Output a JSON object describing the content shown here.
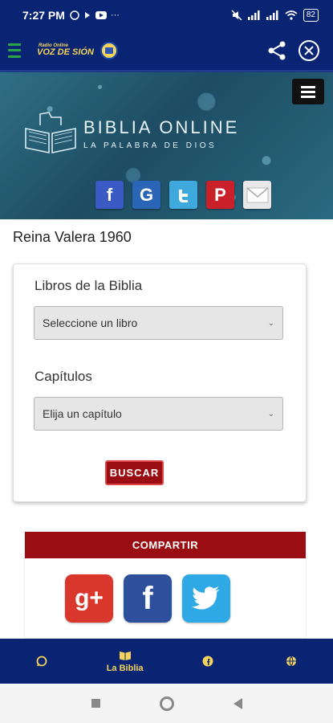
{
  "status_bar": {
    "time": "7:27 PM",
    "battery": "82"
  },
  "app_bar": {
    "brand_small": "Radio Online",
    "brand_big": "VOZ DE SIÓN"
  },
  "banner": {
    "title": "BIBLIA ONLINE",
    "subtitle": "LA PALABRA DE DIOS",
    "share_icons": [
      "facebook-icon",
      "google-icon",
      "twitter-icon",
      "pinterest-icon",
      "mail-icon"
    ]
  },
  "content": {
    "version_title": "Reina Valera 1960",
    "books_label": "Libros de la Biblia",
    "books_select": "Seleccione un libro",
    "chapters_label": "Capítulos",
    "chapters_select": "Elija un capítulo",
    "search_button": "BUSCAR"
  },
  "share_panel": {
    "header": "COMPARTIR"
  },
  "bottom_nav": {
    "items": [
      {
        "icon": "whatsapp-icon",
        "label": ""
      },
      {
        "icon": "bible-icon",
        "label": "La Biblia"
      },
      {
        "icon": "facebook-icon",
        "label": ""
      },
      {
        "icon": "globe-icon",
        "label": ""
      }
    ]
  },
  "colors": {
    "primary": "#0a2474",
    "accent": "#f3d35a",
    "button": "#9a0d12"
  }
}
